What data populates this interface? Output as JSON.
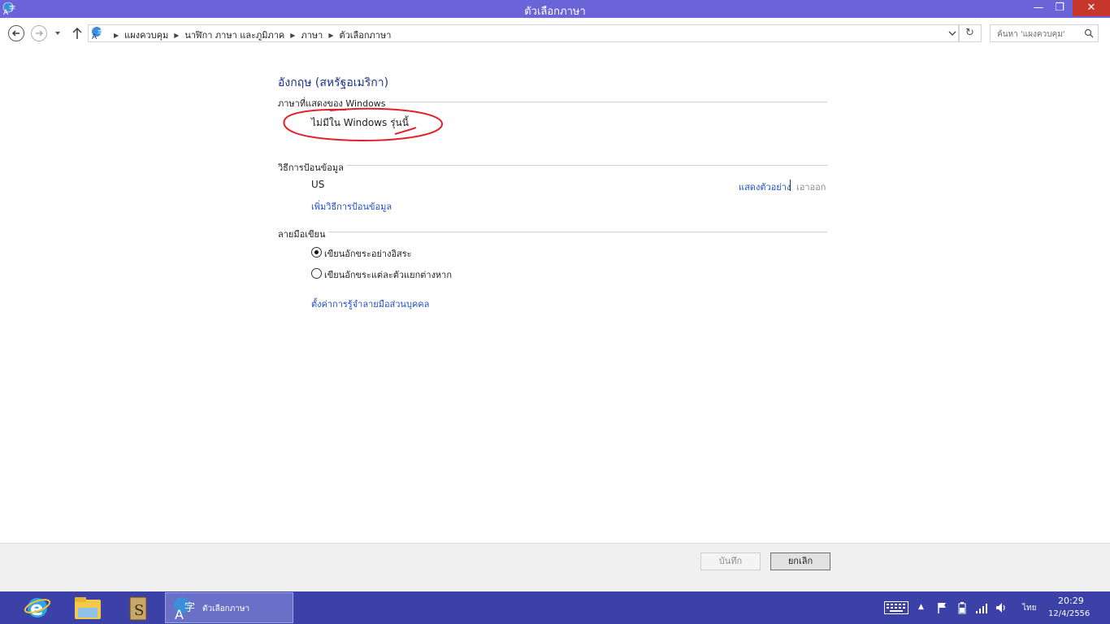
{
  "window": {
    "title": "ตัวเลือกภาษา",
    "minimize_glyph": "—",
    "maximize_glyph": "❐",
    "close_glyph": "✕",
    "title_bar_color": "#6b64d8"
  },
  "address_bar": {
    "breadcrumbs": [
      "แผงควบคุม",
      "นาฬิกา ภาษา และภูมิภาค",
      "ภาษา",
      "ตัวเลือกภาษา"
    ],
    "separator_glyph": "▶",
    "refresh_glyph": "↻",
    "search_placeholder": "ค้นหา 'แผงควบคุม'"
  },
  "content": {
    "language_title": "อังกฤษ (สหรัฐอเมริกา)",
    "display_language": {
      "heading": "ภาษาที่แสดงของ Windows",
      "value": "ไม่มีใน Windows รุ่นนี้"
    },
    "input_method": {
      "heading": "วิธีการป้อนข้อมูล",
      "method_name": "US",
      "preview_link": "แสดงตัวอย่าง",
      "remove_link": "เอาออก",
      "add_link": "เพิ่มวิธีการป้อนข้อมูล"
    },
    "handwriting": {
      "heading": "ลายมือเขียน",
      "options": [
        {
          "label": "เขียนอักขระอย่างอิสระ",
          "selected": true
        },
        {
          "label": "เขียนอักขระแต่ละตัวแยกต่างหาก",
          "selected": false
        }
      ],
      "personalize_link": "ตั้งค่าการรู้จำลายมือส่วนบุคคล"
    },
    "annotation_color": "#e0202a"
  },
  "buttons": {
    "save_label": "บันทึก",
    "cancel_label": "ยกเลิก"
  },
  "taskbar": {
    "pinned": [
      "internet-explorer-icon",
      "file-explorer-icon",
      "s-app-icon"
    ],
    "active_task_label": "ตัวเลือกภาษา",
    "tray_expand_glyph": "▲",
    "language_indicator": "ไทย",
    "time": "20:29",
    "date": "12/4/2556",
    "color": "#3b41a6"
  }
}
